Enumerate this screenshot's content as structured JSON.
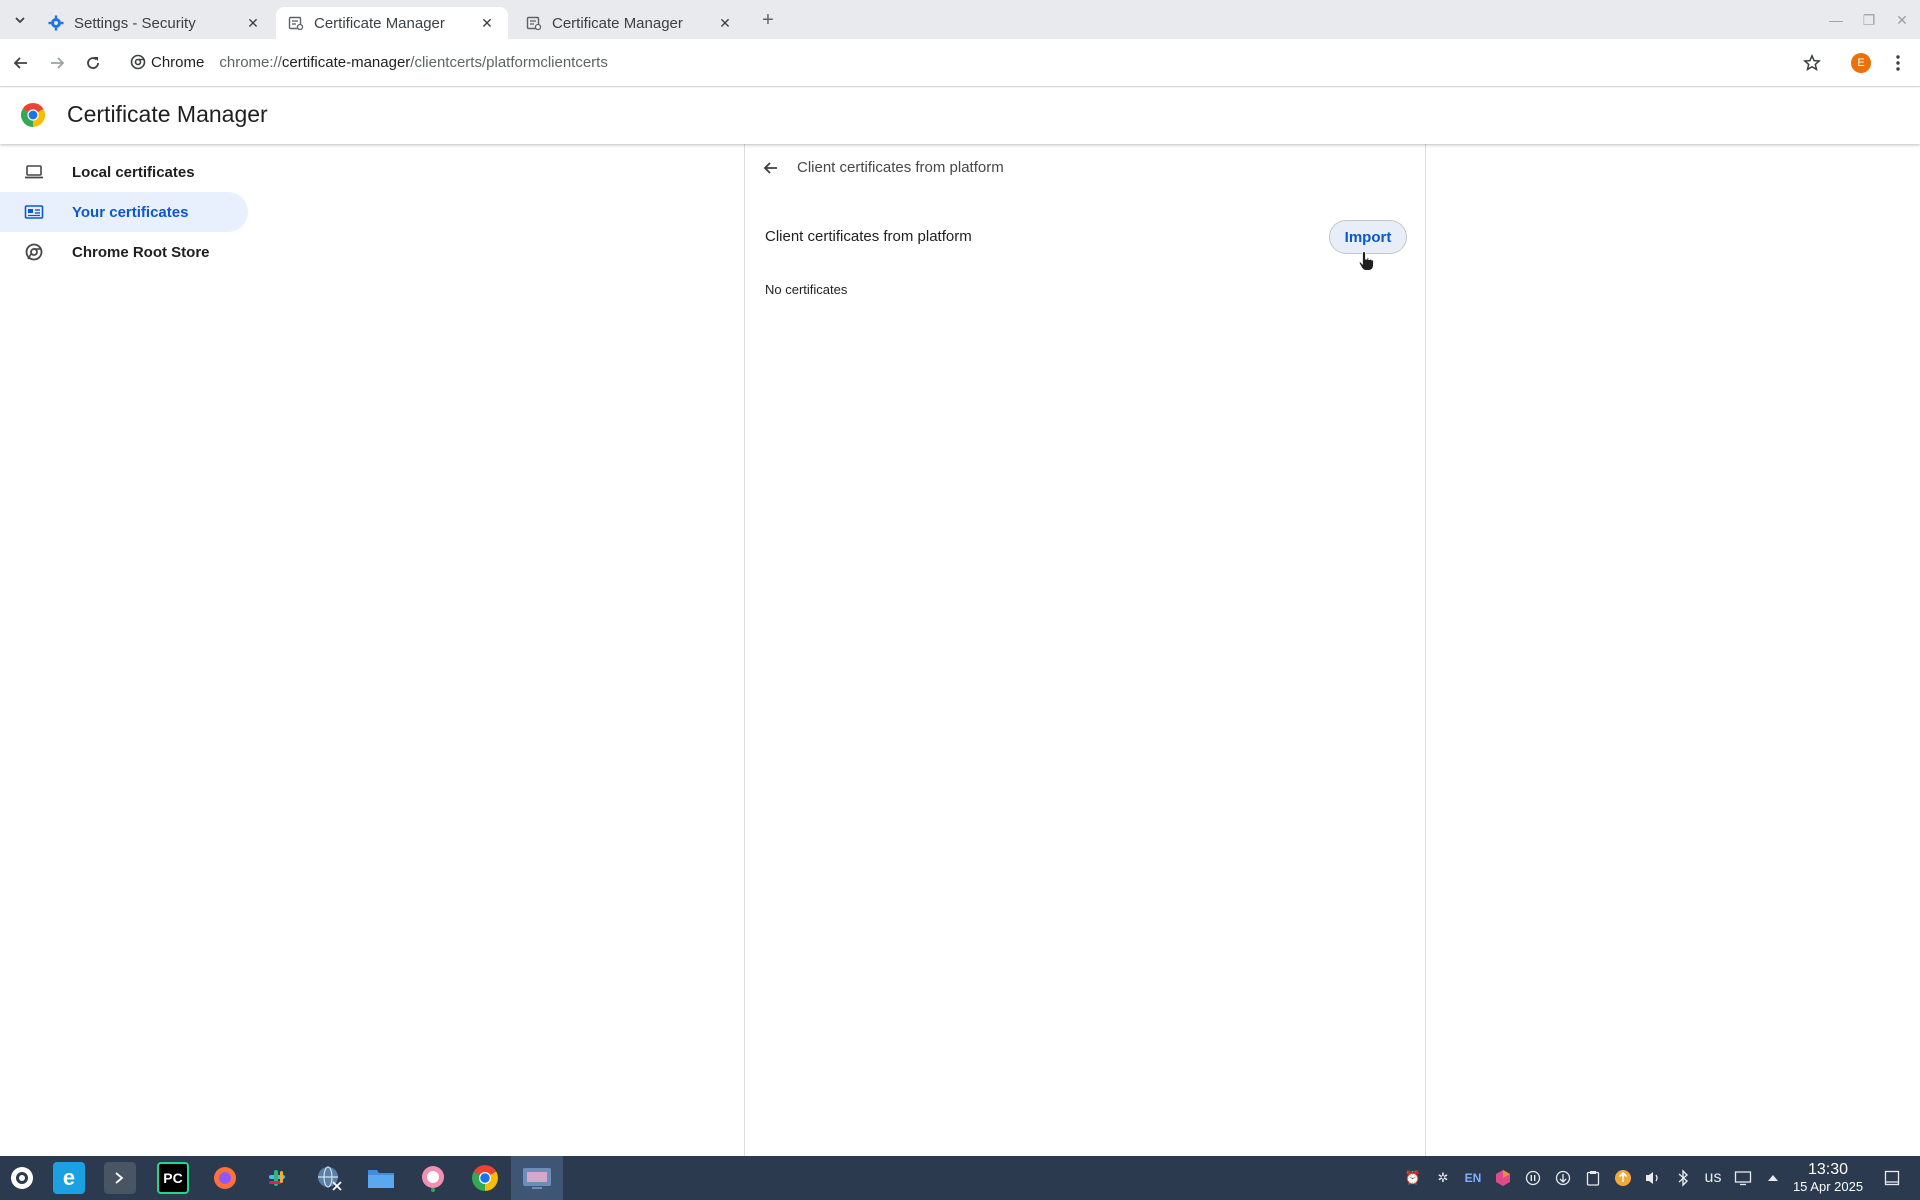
{
  "browser": {
    "tabs": [
      {
        "title": "Settings - Security",
        "icon": "gear-icon",
        "active": false
      },
      {
        "title": "Certificate Manager",
        "icon": "certificate-icon",
        "active": true
      },
      {
        "title": "Certificate Manager",
        "icon": "certificate-icon",
        "active": false
      }
    ],
    "new_tab_glyph": "+",
    "omnibox": {
      "chip_label": "Chrome",
      "url_scheme": "chrome://",
      "url_host": "certificate-manager",
      "url_path": "/clientcerts/platformclientcerts"
    },
    "profile_initial": "E"
  },
  "app": {
    "title": "Certificate Manager"
  },
  "sidebar": {
    "items": [
      {
        "label": "Local certificates",
        "icon": "laptop-icon",
        "selected": false
      },
      {
        "label": "Your certificates",
        "icon": "id-card-icon",
        "selected": true
      },
      {
        "label": "Chrome Root Store",
        "icon": "chrome-icon",
        "selected": false
      }
    ]
  },
  "main": {
    "subpage_title": "Client certificates from platform",
    "section_title": "Client certificates from platform",
    "import_label": "Import",
    "empty_text": "No certificates"
  },
  "taskbar": {
    "apps": [
      "launcher-icon",
      "edge-icon",
      "terminal-icon",
      "pycharm-icon",
      "firefox-icon",
      "slack-icon",
      "network-tool-icon",
      "files-icon",
      "chat-icon",
      "chrome-icon",
      "screen-app-icon"
    ],
    "pycharm_label": "PC",
    "lang": "EN",
    "keyboard_layout": "us",
    "clock_time": "13:30",
    "clock_date": "15 Apr 2025"
  },
  "colors": {
    "accent": "#0b57d0",
    "selected_bg": "#e8f0fe",
    "taskbar_bg": "#2b3a4e",
    "avatar": "#e8710a"
  }
}
